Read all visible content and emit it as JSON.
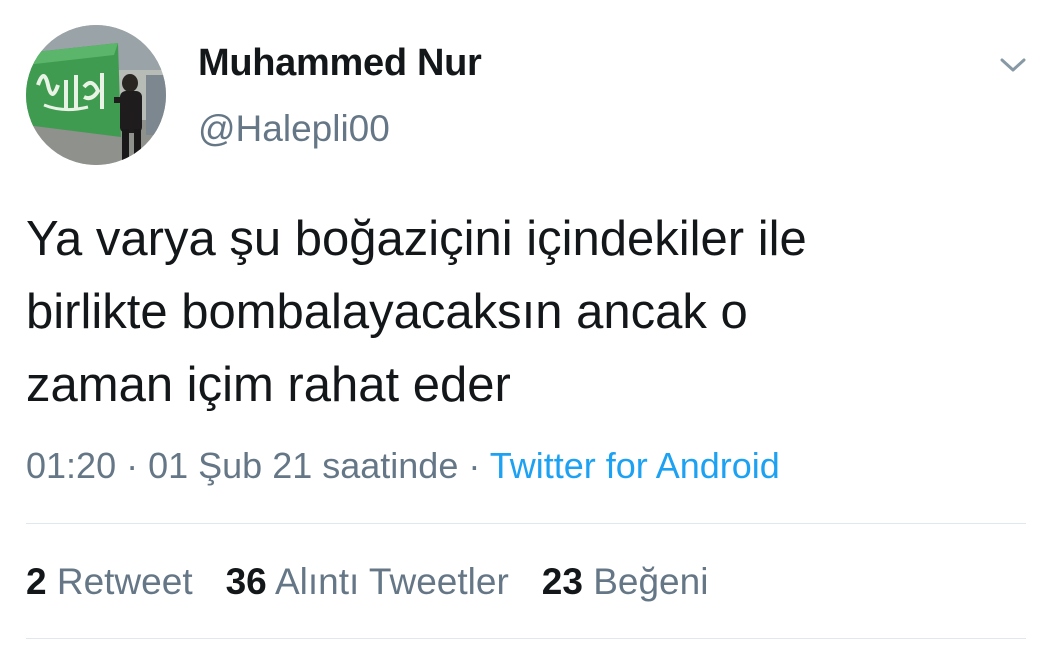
{
  "user": {
    "display_name": "Muhammed Nur",
    "handle": "@Halepli00",
    "avatar": "profile-photo"
  },
  "menu_icon": "chevron-down-icon",
  "tweet": {
    "lines": [
      "Ya varya şu boğaziçini içindekiler ile",
      "birlikte bombalayacaksın ancak o",
      "zaman içim rahat eder"
    ]
  },
  "meta": {
    "time": "01:20",
    "separator1": " · ",
    "date": "01 Şub 21 saatinde",
    "separator2": " · ",
    "source": "Twitter for Android"
  },
  "stats": {
    "retweets_count": "2",
    "retweets_label": "Retweet",
    "quotes_count": "36",
    "quotes_label": "Alıntı Tweetler",
    "likes_count": "23",
    "likes_label": "Beğeni"
  },
  "colors": {
    "text": "#14171a",
    "secondary": "#657786",
    "link": "#1da1f2",
    "divider": "#e1e8ed"
  }
}
